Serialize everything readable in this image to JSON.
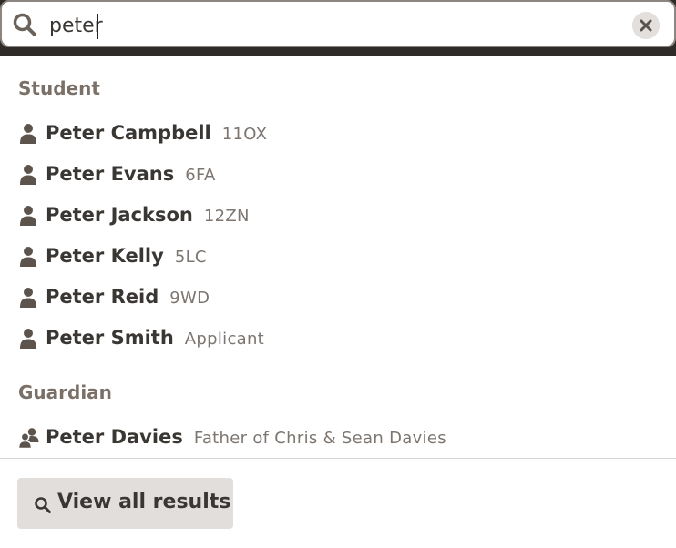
{
  "search": {
    "query": "peter",
    "icon": "search-icon",
    "clear_icon": "close-icon"
  },
  "sections": [
    {
      "title": "Student",
      "items": [
        {
          "name": "Peter Campbell",
          "meta": "11OX",
          "icon": "user-icon"
        },
        {
          "name": "Peter Evans",
          "meta": "6FA",
          "icon": "user-icon"
        },
        {
          "name": "Peter Jackson",
          "meta": "12ZN",
          "icon": "user-icon"
        },
        {
          "name": "Peter Kelly",
          "meta": "5LC",
          "icon": "user-icon"
        },
        {
          "name": "Peter Reid",
          "meta": "9WD",
          "icon": "user-icon"
        },
        {
          "name": "Peter Smith",
          "meta": "Applicant",
          "icon": "user-icon"
        }
      ]
    },
    {
      "title": "Guardian",
      "items": [
        {
          "name": "Peter Davies",
          "meta": "Father of Chris & Sean Davies",
          "icon": "users-icon"
        }
      ]
    }
  ],
  "footer": {
    "view_all_label": "View all results",
    "icon": "search-icon"
  },
  "colors": {
    "search_bar_bg": "#2f2b28",
    "section_header": "#7a7067",
    "button_bg": "#e1dedb"
  }
}
